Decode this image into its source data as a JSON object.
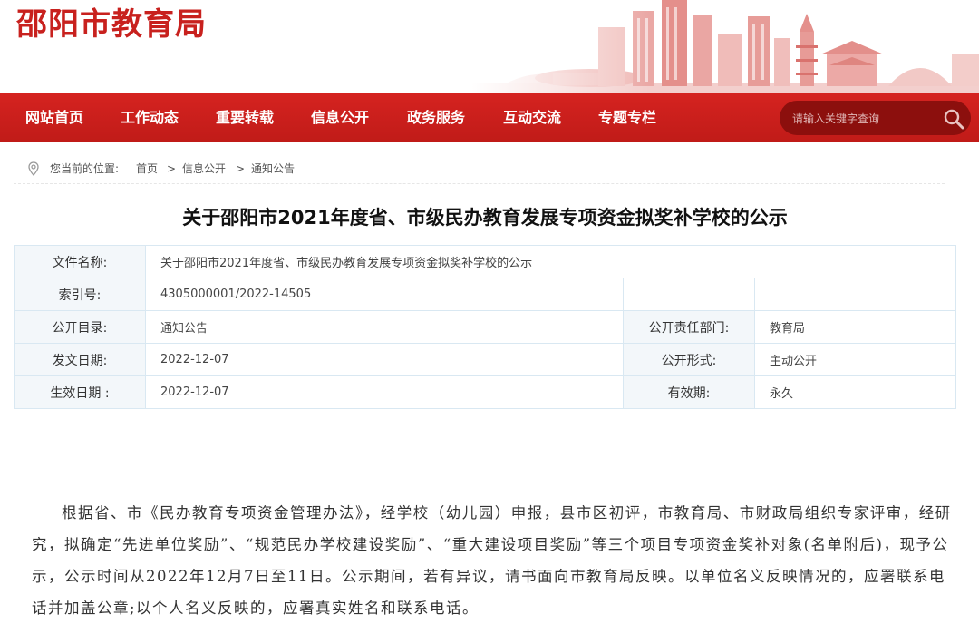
{
  "header": {
    "site_title": "邵阳市教育局"
  },
  "nav": {
    "items": [
      "网站首页",
      "工作动态",
      "重要转载",
      "信息公开",
      "政务服务",
      "互动交流",
      "专题专栏"
    ],
    "search_placeholder": "请输入关键字查询"
  },
  "breadcrumb": {
    "prefix": "您当前的位置:",
    "items": [
      "首页",
      "信息公开",
      "通知公告"
    ],
    "separator": ">"
  },
  "article": {
    "title": "关于邵阳市2021年度省、市级民办教育发展专项资金拟奖补学校的公示",
    "meta": {
      "file_name_label": "文件名称:",
      "file_name": "关于邵阳市2021年度省、市级民办教育发展专项资金拟奖补学校的公示",
      "index_label": "索引号:",
      "index": "4305000001/2022-14505",
      "catalog_label": "公开目录:",
      "catalog": "通知公告",
      "dept_label": "公开责任部门:",
      "dept": "教育局",
      "issue_date_label": "发文日期:",
      "issue_date": "2022-12-07",
      "form_label": "公开形式:",
      "form": "主动公开",
      "effective_label": "生效日期 :",
      "effective_date": "2022-12-07",
      "validity_label": "有效期:",
      "validity": "永久"
    },
    "body": "根据省、市《民办教育专项资金管理办法》，经学校（幼儿园）申报，县市区初评，市教育局、市财政局组织专家评审，经研究，拟确定“先进单位奖励”、“规范民办学校建设奖励”、“重大建设项目奖励”等三个项目专项资金奖补对象(名单附后)，现予公示，公示时间从2022年12月7日至11日。公示期间，若有异议，请书面向市教育局反映。以单位名义反映情况的，应署联系电话并加盖公章;以个人名义反映的，应署真实姓名和联系电话。"
  },
  "colors": {
    "brand_red": "#c8211e",
    "nav_red": "#d52320",
    "search_bg": "#8c0f0d"
  }
}
